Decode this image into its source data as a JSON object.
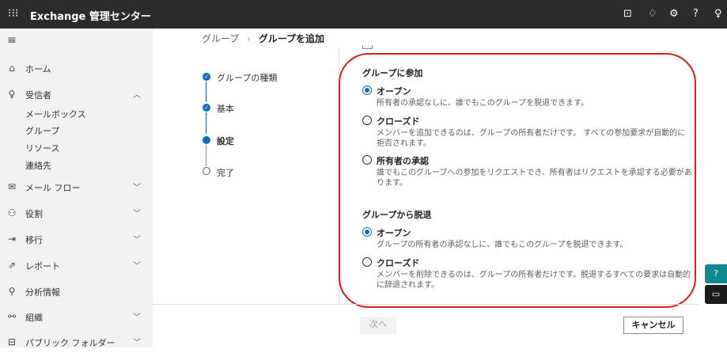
{
  "topbar": {
    "title": "Exchange 管理センター",
    "waffle_icon": "⁝⁝⁝",
    "icons": [
      "⊡",
      "♢",
      "⚙",
      "?",
      "♀"
    ]
  },
  "sidebar": {
    "menu_icon": "≡",
    "items": [
      {
        "icon": "⌂",
        "label": "ホーム",
        "chevron": ""
      },
      {
        "icon": "♀",
        "label": "受信者",
        "chevron": "︿"
      },
      {
        "icon": "✉",
        "label": "メール フロー",
        "chevron": "﹀"
      },
      {
        "icon": "⚇",
        "label": "役割",
        "chevron": "﹀"
      },
      {
        "icon": "⇥",
        "label": "移行",
        "chevron": "﹀"
      },
      {
        "icon": "⇗",
        "label": "レポート",
        "chevron": "﹀"
      },
      {
        "icon": "⚲",
        "label": "分析情報",
        "chevron": ""
      },
      {
        "icon": "⚯",
        "label": "組織",
        "chevron": "﹀"
      },
      {
        "icon": "⊟",
        "label": "パブリック フォルダー",
        "chevron": "﹀"
      }
    ],
    "subitems": [
      "メールボックス",
      "グループ",
      "リソース",
      "連絡先"
    ]
  },
  "breadcrumb": {
    "parent": "グループ",
    "separator": "›",
    "current": "グループを追加"
  },
  "steps": [
    {
      "label": "グループの種類",
      "state": "done",
      "mark": "✓"
    },
    {
      "label": "基本",
      "state": "done",
      "mark": "✓"
    },
    {
      "label": "設定",
      "state": "active",
      "mark": ""
    },
    {
      "label": "完了",
      "state": "todo",
      "mark": ""
    }
  ],
  "join": {
    "heading": "グループに参加",
    "options": [
      {
        "label": "オープン",
        "desc": "所有者の承認なしに、誰でもこのグループを脱退できます。",
        "selected": true
      },
      {
        "label": "クローズド",
        "desc": "メンバーを追加できるのは、グループの所有者だけです。 すべての参加要求が自動的に拒否されます。",
        "selected": false
      },
      {
        "label": "所有者の承認",
        "desc": "誰でもこのグループへの参加をリクエストでき、所有者はリクエストを承認する必要があります。",
        "selected": false
      }
    ]
  },
  "leave": {
    "heading": "グループから脱退",
    "options": [
      {
        "label": "オープン",
        "desc": "グループの所有者の承認なしに、誰でもこのグループを脱退できます。",
        "selected": true
      },
      {
        "label": "クローズド",
        "desc": "メンバーを削除できるのは、グループの所有者だけです。脱退するすべての要求は自動的に辞退されます。",
        "selected": false
      }
    ]
  },
  "footer": {
    "next": "次へ",
    "cancel": "キャンセル"
  },
  "floating": {
    "help_icon": "?",
    "feedback_icon": "▭"
  },
  "colors": {
    "accent": "#0f6cbd",
    "highlight": "#e01b1b",
    "topbar": "#2b2b2b",
    "help_button": "#0b8a8f"
  }
}
